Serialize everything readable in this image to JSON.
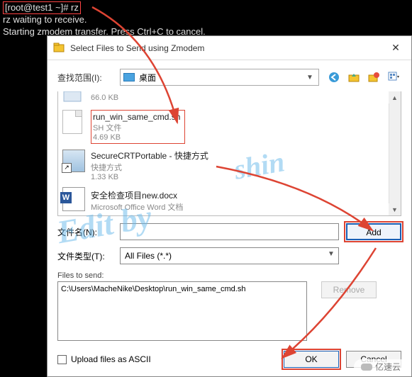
{
  "terminal": {
    "prompt": "[root@test1 ~]# rz",
    "line1": "rz waiting to receive.",
    "line2": "Starting zmodem transfer.  Press Ctrl+C to cancel."
  },
  "dialog": {
    "title": "Select Files to Send using Zmodem",
    "lookin_label": "查找范围(I):",
    "lookin_value": "桌面",
    "filename_label": "文件名(N):",
    "filename_value": "",
    "filetype_label": "文件类型(T):",
    "filetype_value": "All Files (*.*)",
    "add_label": "Add",
    "files_to_send_label": "Files to send:",
    "send_path": "C:\\Users\\MacheNike\\Desktop\\run_win_same_cmd.sh",
    "remove_label": "Remove",
    "upload_ascii_label": "Upload files as ASCII",
    "ok_label": "OK",
    "cancel_label": "Cancel"
  },
  "files": {
    "item0": {
      "size": "66.0 KB"
    },
    "item1": {
      "name": "run_win_same_cmd.sh",
      "type": "SH 文件",
      "size": "4.69 KB"
    },
    "item2": {
      "name": "SecureCRTPortable - 快捷方式",
      "type": "快捷方式",
      "size": "1.33 KB"
    },
    "item3": {
      "name": "安全检查项目new.docx",
      "type": "Microsoft Office Word 文档"
    }
  },
  "watermark": {
    "w1": "shin",
    "w2": "Edit by"
  },
  "logo": "亿速云"
}
